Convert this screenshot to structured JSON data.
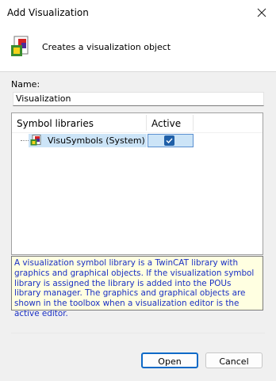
{
  "window": {
    "title": "Add Visualization"
  },
  "header": {
    "text": "Creates a visualization object",
    "icon": "visualization-icon"
  },
  "name_field": {
    "label": "Name:",
    "value": "Visualization"
  },
  "libraries": {
    "columns": [
      "Symbol libraries",
      "Active"
    ],
    "rows": [
      {
        "name": "VisuSymbols (System)",
        "active": true,
        "icon": "library-icon"
      }
    ]
  },
  "description": "A visualization symbol library is a TwinCAT library with graphics and graphical objects. If the visualization symbol library is assigned the library is added into the POUs library manager. The graphics and graphical objects are shown in the toolbox when a visualization editor is the active editor.",
  "buttons": {
    "open": "Open",
    "cancel": "Cancel"
  },
  "colors": {
    "accent": "#0f6ac7",
    "description_text": "#1a2fc4",
    "description_bg": "#ffffe1",
    "selection_bg": "#cce4f7"
  }
}
